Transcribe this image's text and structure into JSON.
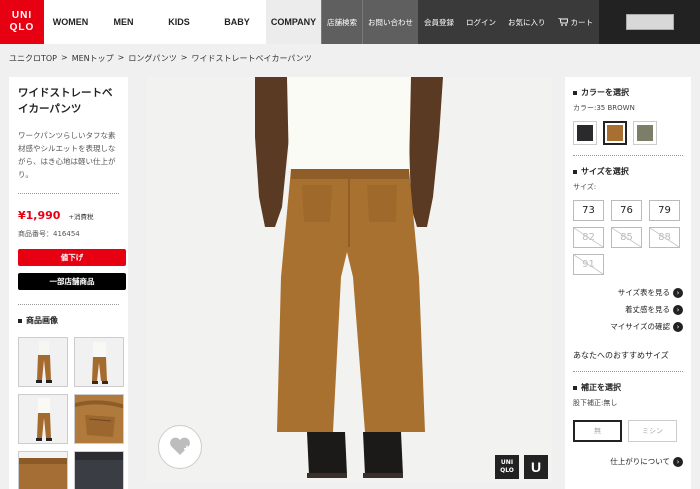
{
  "nav": {
    "logo_line1": "UNI",
    "logo_line2": "QLO",
    "links": [
      "WOMEN",
      "MEN",
      "KIDS",
      "BABY",
      "COMPANY"
    ],
    "util_a": [
      "店舗検索",
      "お問い合わせ"
    ],
    "util_b": [
      "会員登録",
      "ログイン",
      "お気に入り",
      "カート"
    ]
  },
  "breadcrumb": [
    "ユニクロTOP",
    ">",
    "MENトップ",
    ">",
    "ロングパンツ",
    ">",
    "ワイドストレートベイカーパンツ"
  ],
  "product": {
    "title": "ワイドストレートベイカーパンツ",
    "description": "ワークパンツらしいタフな素材感やシルエットを表現しながら、はき心地は軽い仕上がり。",
    "price": "¥1,990",
    "tax": "+消費税",
    "number": "商品番号：416454",
    "sale_label": "値下げ",
    "store_label": "一部店舗商品",
    "images_heading": "商品画像"
  },
  "main_image": {
    "brand_line1": "UNI",
    "brand_line2": "QLO",
    "u_mark": "U"
  },
  "color": {
    "heading": "カラーを選択",
    "current": "カラー:35 BROWN",
    "swatches": [
      {
        "name": "black",
        "hex": "#2a2a2c"
      },
      {
        "name": "brown",
        "hex": "#a86f33"
      },
      {
        "name": "olive",
        "hex": "#7d7e68"
      }
    ]
  },
  "size": {
    "heading": "サイズを選択",
    "label": "サイズ:",
    "available": [
      "73",
      "76",
      "79"
    ],
    "unavailable": [
      "82",
      "85",
      "88",
      "91"
    ]
  },
  "links": [
    "サイズ表を見る",
    "着丈感を見る",
    "マイサイズの確認"
  ],
  "recommend": "あなたへのおすすめサイズ",
  "hem": {
    "heading": "補正を選択",
    "sub": "股下補正:無し",
    "options": [
      "無",
      "ミシン"
    ]
  },
  "finish_link": "仕上がりについて"
}
